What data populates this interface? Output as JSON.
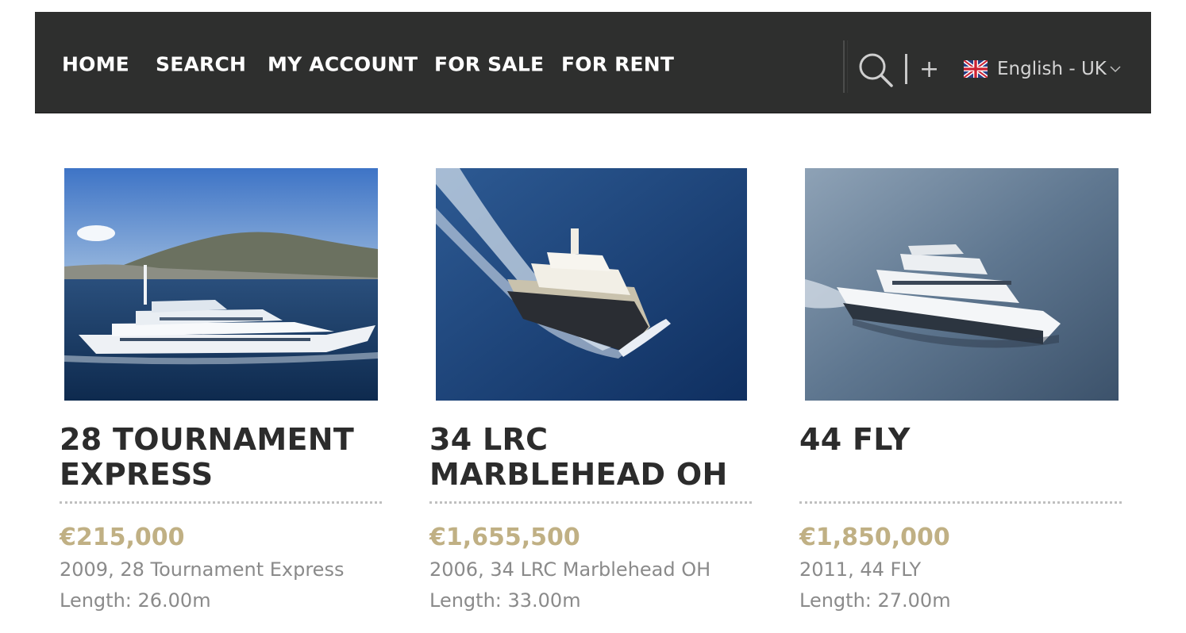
{
  "nav": {
    "items": [
      {
        "label": "HOME"
      },
      {
        "label": "SEARCH"
      },
      {
        "label": "MY ACCOUNT"
      },
      {
        "label": "FOR SALE"
      },
      {
        "label": "FOR RENT"
      }
    ],
    "language": "English - UK",
    "plus_symbol": "+",
    "icons": [
      "search-icon",
      "plus-icon",
      "uk-flag-icon",
      "chevron-down-icon"
    ],
    "background_color": "#2e2f2e"
  },
  "listings": [
    {
      "title": "28 TOURNAMENT EXPRESS",
      "price": "€215,000",
      "description": "2009, 28 Tournament Express",
      "length": "Length: 26.00m"
    },
    {
      "title": "34 LRC MARBLEHEAD OH",
      "price": "€1,655,500",
      "description": "2006, 34 LRC Marblehead OH",
      "length": "Length: 33.00m"
    },
    {
      "title": "44 FLY",
      "price": "€1,850,000",
      "description": "2011, 44 FLY",
      "length": "Length: 27.00m"
    }
  ],
  "colors": {
    "price": "#c0b084",
    "title": "#2c2c2c",
    "meta_text": "#8a8a8a"
  }
}
